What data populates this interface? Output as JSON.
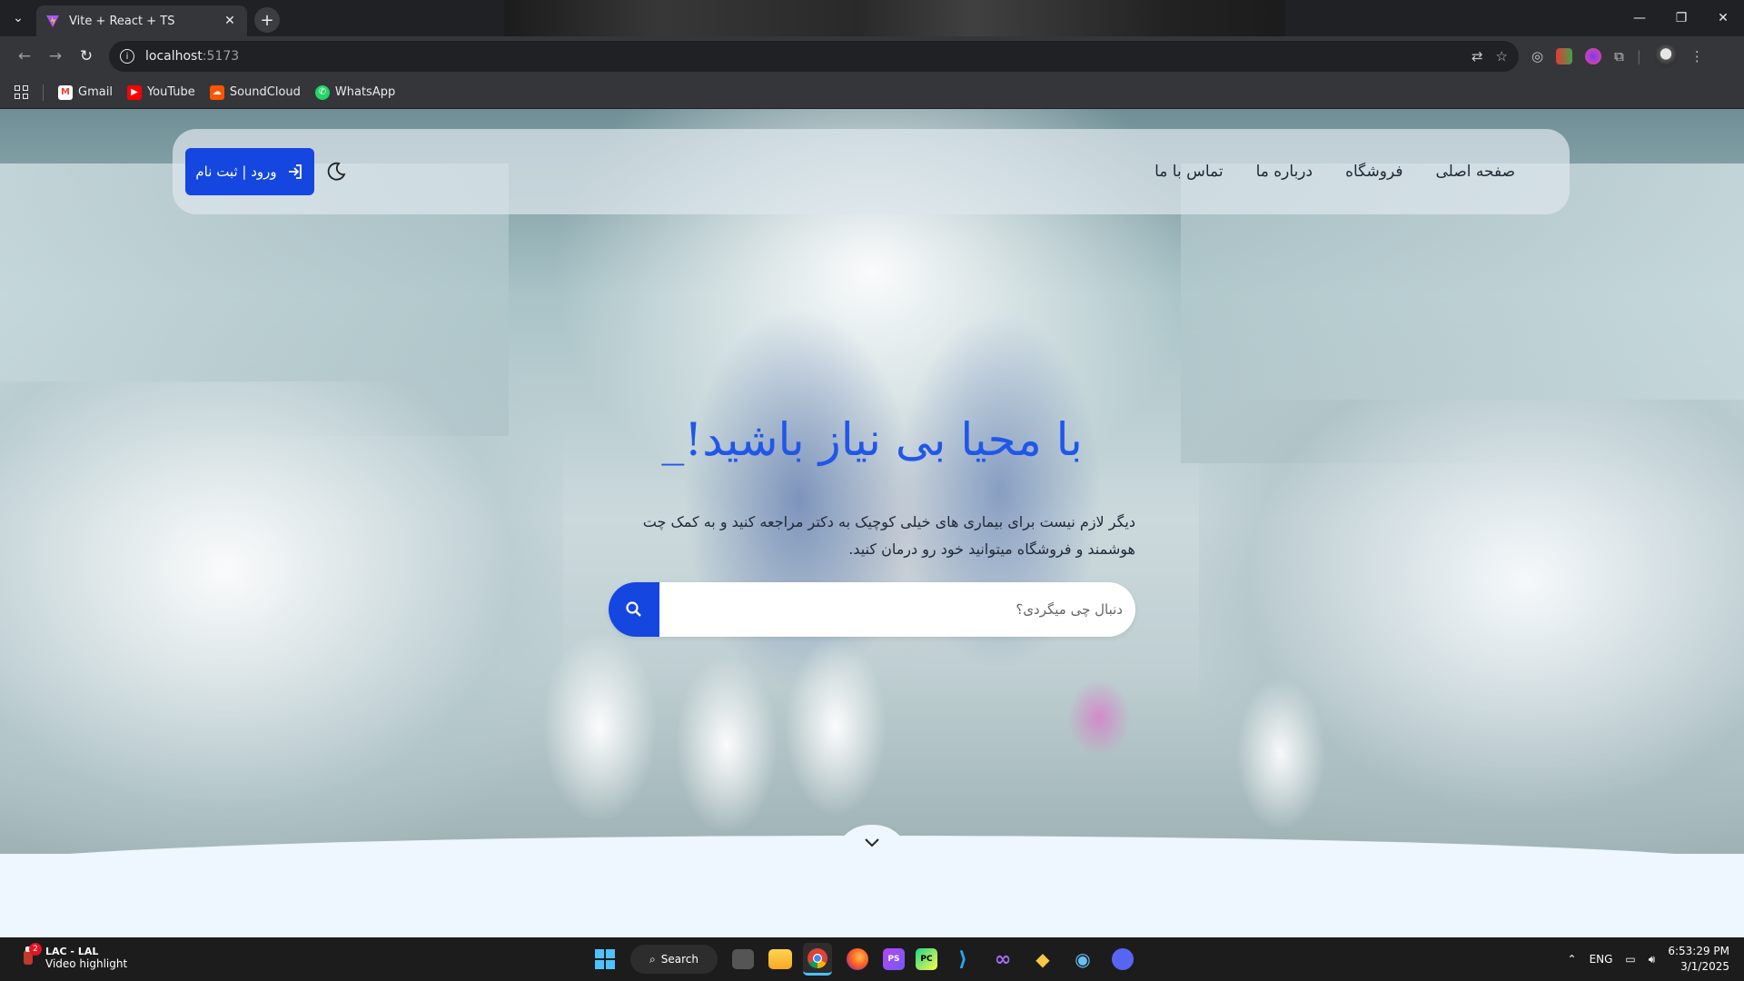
{
  "browser": {
    "tab_title": "Vite + React + TS",
    "url_host": "localhost",
    "url_port": ":5173",
    "bookmarks": [
      {
        "label": "Gmail",
        "icon": "gmail-icon",
        "color": "#ea4335"
      },
      {
        "label": "YouTube",
        "icon": "youtube-icon",
        "color": "#ff0000"
      },
      {
        "label": "SoundCloud",
        "icon": "soundcloud-icon",
        "color": "#ff5500"
      },
      {
        "label": "WhatsApp",
        "icon": "whatsapp-icon",
        "color": "#25d366"
      }
    ]
  },
  "navbar": {
    "links": [
      "صفحه اصلی",
      "فروشگاه",
      "درباره ما",
      "تماس با ما"
    ],
    "login_label": "ورود | ثبت نام",
    "accent": "#1546e0"
  },
  "hero": {
    "title": "با محیا بی نیاز باشید!",
    "cursor": "_",
    "subtitle": "دیگر لازم نیست برای بیماری های خیلی کوچیک به دکتر مراجعه کنید و به کمک چت هوشمند و فروشگاه میتوانید خود رو درمان کنید.",
    "search_placeholder": "دنبال چی میگردی؟",
    "title_color": "#2057e8"
  },
  "taskbar": {
    "notification_title": "LAC - LAL",
    "notification_text": "Video highlight",
    "notification_badge": "2",
    "search_label": "Search",
    "language": "ENG",
    "time": "6:53:29 PM",
    "date": "3/1/2025"
  }
}
